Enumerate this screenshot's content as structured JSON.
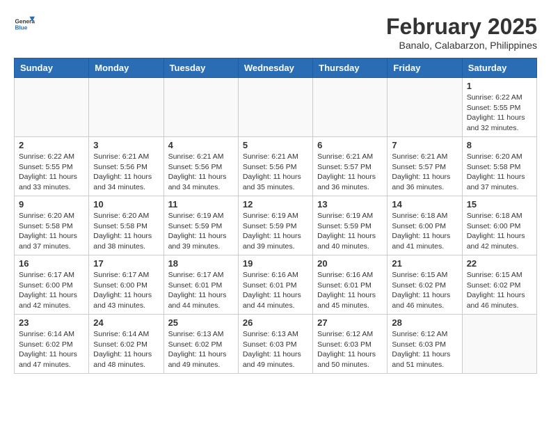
{
  "header": {
    "logo_general": "General",
    "logo_blue": "Blue",
    "title": "February 2025",
    "subtitle": "Banalo, Calabarzon, Philippines"
  },
  "days_of_week": [
    "Sunday",
    "Monday",
    "Tuesday",
    "Wednesday",
    "Thursday",
    "Friday",
    "Saturday"
  ],
  "weeks": [
    [
      {
        "day": "",
        "info": ""
      },
      {
        "day": "",
        "info": ""
      },
      {
        "day": "",
        "info": ""
      },
      {
        "day": "",
        "info": ""
      },
      {
        "day": "",
        "info": ""
      },
      {
        "day": "",
        "info": ""
      },
      {
        "day": "1",
        "info": "Sunrise: 6:22 AM\nSunset: 5:55 PM\nDaylight: 11 hours and 32 minutes."
      }
    ],
    [
      {
        "day": "2",
        "info": "Sunrise: 6:22 AM\nSunset: 5:55 PM\nDaylight: 11 hours and 33 minutes."
      },
      {
        "day": "3",
        "info": "Sunrise: 6:21 AM\nSunset: 5:56 PM\nDaylight: 11 hours and 34 minutes."
      },
      {
        "day": "4",
        "info": "Sunrise: 6:21 AM\nSunset: 5:56 PM\nDaylight: 11 hours and 34 minutes."
      },
      {
        "day": "5",
        "info": "Sunrise: 6:21 AM\nSunset: 5:56 PM\nDaylight: 11 hours and 35 minutes."
      },
      {
        "day": "6",
        "info": "Sunrise: 6:21 AM\nSunset: 5:57 PM\nDaylight: 11 hours and 36 minutes."
      },
      {
        "day": "7",
        "info": "Sunrise: 6:21 AM\nSunset: 5:57 PM\nDaylight: 11 hours and 36 minutes."
      },
      {
        "day": "8",
        "info": "Sunrise: 6:20 AM\nSunset: 5:58 PM\nDaylight: 11 hours and 37 minutes."
      }
    ],
    [
      {
        "day": "9",
        "info": "Sunrise: 6:20 AM\nSunset: 5:58 PM\nDaylight: 11 hours and 37 minutes."
      },
      {
        "day": "10",
        "info": "Sunrise: 6:20 AM\nSunset: 5:58 PM\nDaylight: 11 hours and 38 minutes."
      },
      {
        "day": "11",
        "info": "Sunrise: 6:19 AM\nSunset: 5:59 PM\nDaylight: 11 hours and 39 minutes."
      },
      {
        "day": "12",
        "info": "Sunrise: 6:19 AM\nSunset: 5:59 PM\nDaylight: 11 hours and 39 minutes."
      },
      {
        "day": "13",
        "info": "Sunrise: 6:19 AM\nSunset: 5:59 PM\nDaylight: 11 hours and 40 minutes."
      },
      {
        "day": "14",
        "info": "Sunrise: 6:18 AM\nSunset: 6:00 PM\nDaylight: 11 hours and 41 minutes."
      },
      {
        "day": "15",
        "info": "Sunrise: 6:18 AM\nSunset: 6:00 PM\nDaylight: 11 hours and 42 minutes."
      }
    ],
    [
      {
        "day": "16",
        "info": "Sunrise: 6:17 AM\nSunset: 6:00 PM\nDaylight: 11 hours and 42 minutes."
      },
      {
        "day": "17",
        "info": "Sunrise: 6:17 AM\nSunset: 6:00 PM\nDaylight: 11 hours and 43 minutes."
      },
      {
        "day": "18",
        "info": "Sunrise: 6:17 AM\nSunset: 6:01 PM\nDaylight: 11 hours and 44 minutes."
      },
      {
        "day": "19",
        "info": "Sunrise: 6:16 AM\nSunset: 6:01 PM\nDaylight: 11 hours and 44 minutes."
      },
      {
        "day": "20",
        "info": "Sunrise: 6:16 AM\nSunset: 6:01 PM\nDaylight: 11 hours and 45 minutes."
      },
      {
        "day": "21",
        "info": "Sunrise: 6:15 AM\nSunset: 6:02 PM\nDaylight: 11 hours and 46 minutes."
      },
      {
        "day": "22",
        "info": "Sunrise: 6:15 AM\nSunset: 6:02 PM\nDaylight: 11 hours and 46 minutes."
      }
    ],
    [
      {
        "day": "23",
        "info": "Sunrise: 6:14 AM\nSunset: 6:02 PM\nDaylight: 11 hours and 47 minutes."
      },
      {
        "day": "24",
        "info": "Sunrise: 6:14 AM\nSunset: 6:02 PM\nDaylight: 11 hours and 48 minutes."
      },
      {
        "day": "25",
        "info": "Sunrise: 6:13 AM\nSunset: 6:02 PM\nDaylight: 11 hours and 49 minutes."
      },
      {
        "day": "26",
        "info": "Sunrise: 6:13 AM\nSunset: 6:03 PM\nDaylight: 11 hours and 49 minutes."
      },
      {
        "day": "27",
        "info": "Sunrise: 6:12 AM\nSunset: 6:03 PM\nDaylight: 11 hours and 50 minutes."
      },
      {
        "day": "28",
        "info": "Sunrise: 6:12 AM\nSunset: 6:03 PM\nDaylight: 11 hours and 51 minutes."
      },
      {
        "day": "",
        "info": ""
      }
    ]
  ]
}
